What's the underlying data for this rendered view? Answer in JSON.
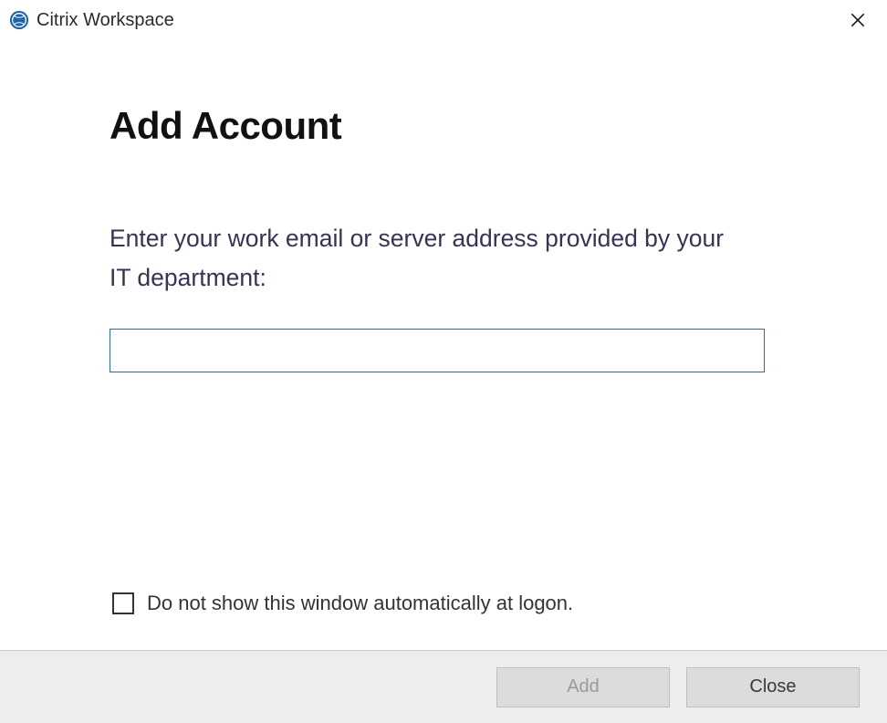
{
  "titlebar": {
    "app_title": "Citrix Workspace"
  },
  "content": {
    "heading": "Add Account",
    "instruction": "Enter your work email or server address provided by your IT department:",
    "address_value": ""
  },
  "options": {
    "dont_show_label": "Do not show this window automatically at logon.",
    "dont_show_checked": false
  },
  "buttons": {
    "add_label": "Add",
    "close_label": "Close",
    "add_enabled": false
  },
  "colors": {
    "input_border": "#2b6ca3",
    "button_bar_bg": "#ededed",
    "icon_blue": "#1e66a8"
  }
}
